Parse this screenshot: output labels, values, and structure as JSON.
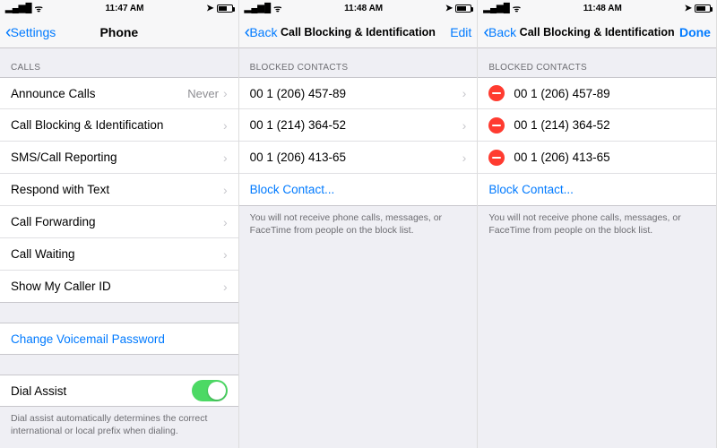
{
  "screen1": {
    "status": {
      "time": "11:47 AM",
      "signal": "●●●●",
      "carrier": "▂▄▆█",
      "wifi": "⋮ ᯤ",
      "alarm": "⏰",
      "battery_pct": ""
    },
    "nav": {
      "back": "Settings",
      "title": "Phone"
    },
    "calls_header": "CALLS",
    "rows": {
      "announce": {
        "label": "Announce Calls",
        "detail": "Never"
      },
      "blocking": {
        "label": "Call Blocking & Identification"
      },
      "sms": {
        "label": "SMS/Call Reporting"
      },
      "respond": {
        "label": "Respond with Text"
      },
      "forwarding": {
        "label": "Call Forwarding"
      },
      "waiting": {
        "label": "Call Waiting"
      },
      "callerid": {
        "label": "Show My Caller ID"
      },
      "voicemail": {
        "label": "Change Voicemail Password"
      },
      "dialassist": {
        "label": "Dial Assist"
      }
    },
    "dialassist_note": "Dial assist automatically determines the correct international or local prefix when dialing."
  },
  "screen2": {
    "status": {
      "time": "11:48 AM"
    },
    "nav": {
      "back": "Back",
      "title": "Call Blocking & Identification",
      "right": "Edit"
    },
    "section_header": "BLOCKED CONTACTS",
    "contacts": [
      "00 1 (206) 457-89",
      "00 1 (214) 364-52",
      "00 1 (206) 413-65"
    ],
    "block_contact": "Block Contact...",
    "footer": "You will not receive phone calls, messages, or FaceTime from people on the block list."
  },
  "screen3": {
    "status": {
      "time": "11:48 AM"
    },
    "nav": {
      "back": "Back",
      "title": "Call Blocking & Identification",
      "right": "Done"
    },
    "section_header": "BLOCKED CONTACTS",
    "contacts": [
      "00 1 (206) 457-89",
      "00 1 (214) 364-52",
      "00 1 (206) 413-65"
    ],
    "block_contact": "Block Contact...",
    "footer": "You will not receive phone calls, messages, or FaceTime from people on the block list."
  }
}
